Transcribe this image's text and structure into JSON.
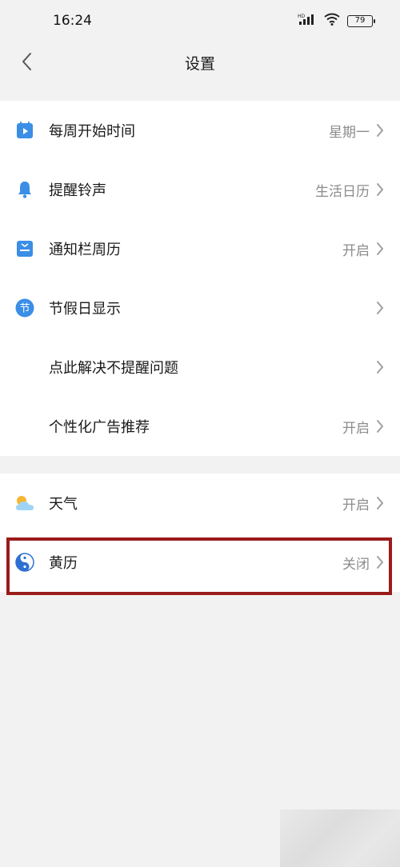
{
  "status_bar": {
    "time": "16:24",
    "battery": "79",
    "signal_label": "HD"
  },
  "header": {
    "title": "设置"
  },
  "colors": {
    "accent": "#3a8ee6",
    "highlight_border": "#9b1b1b"
  },
  "groups": [
    {
      "items": [
        {
          "icon": "calendar-play-icon",
          "label": "每周开始时间",
          "value": "星期一"
        },
        {
          "icon": "bell-icon",
          "label": "提醒铃声",
          "value": "生活日历"
        },
        {
          "icon": "notification-calendar-icon",
          "label": "通知栏周历",
          "value": "开启"
        },
        {
          "icon": "holiday-icon",
          "label": "节假日显示",
          "value": ""
        },
        {
          "icon": "",
          "label": "点此解决不提醒问题",
          "value": ""
        },
        {
          "icon": "",
          "label": "个性化广告推荐",
          "value": "开启"
        }
      ]
    },
    {
      "items": [
        {
          "icon": "weather-icon",
          "label": "天气",
          "value": "开启"
        },
        {
          "icon": "yin-yang-icon",
          "label": "黄历",
          "value": "关闭"
        }
      ]
    }
  ],
  "holiday_icon_glyph": "节"
}
